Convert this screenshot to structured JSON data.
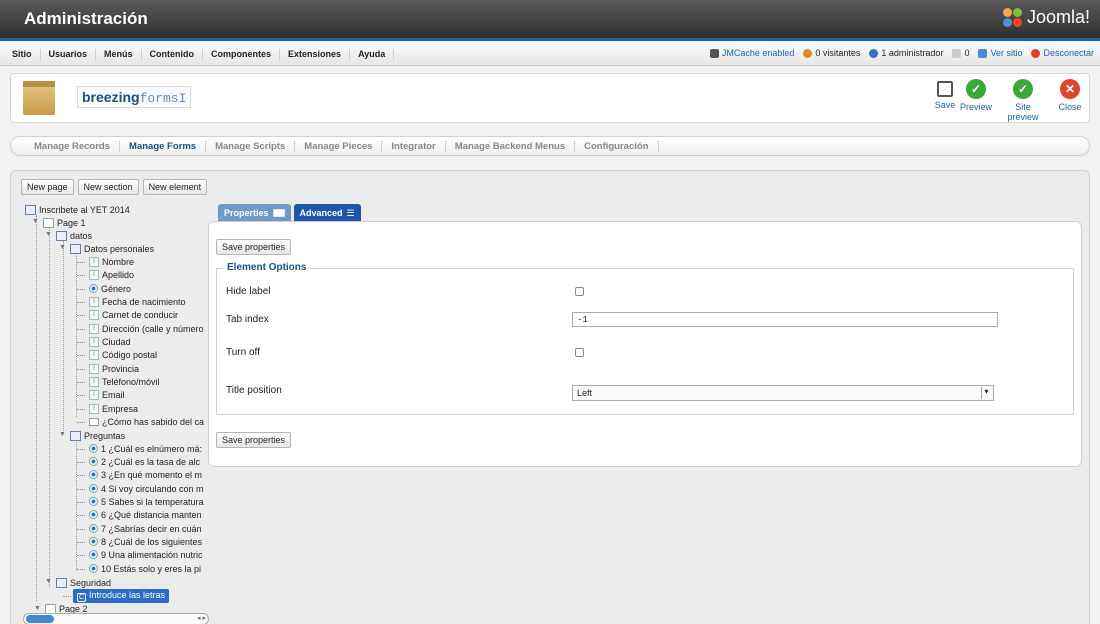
{
  "header": {
    "title": "Administración",
    "logo_text": "Joomla!"
  },
  "menu": {
    "items": [
      "Sitio",
      "Usuarios",
      "Menús",
      "Contenido",
      "Componentes",
      "Extensiones",
      "Ayuda"
    ]
  },
  "status": {
    "jmcache": "JMCache enabled",
    "visitors": "0 visitantes",
    "admins": "1 administrador",
    "messages": "0",
    "view_site": "Ver sitio",
    "logout": "Desconectar"
  },
  "toolbar": {
    "brand_bold": "breezing",
    "brand_light": "forms",
    "save": "Save",
    "preview": "Preview",
    "site_preview": "Site preview",
    "close": "Close"
  },
  "tabs": [
    "Manage Records",
    "Manage Forms",
    "Manage Scripts",
    "Manage Pieces",
    "Integrator",
    "Manage Backend Menus",
    "Configuración"
  ],
  "new_buttons": [
    "New page",
    "New section",
    "New element"
  ],
  "tree": {
    "root": "Inscribete al YET 2014",
    "page1": "Page 1",
    "datos": "datos",
    "datos_personales": "Datos personales",
    "fields": [
      "Nombre",
      "Apellido",
      "Género",
      "Fecha de nacimiento",
      "Carnet de conducir",
      "Dirección (calle y número",
      "Ciudad",
      "Código postal",
      "Provincia",
      "Teléfono/móvil",
      "Email",
      "Empresa",
      "¿Cómo has sabido del ca"
    ],
    "preguntas": "Preguntas",
    "questions": [
      "1 ¿Cuál es elnúmero má:",
      "2 ¿Cuál es la tasa de alc",
      "3 ¿En qué momento el m",
      "4 Si voy circulando con m",
      "5 Sabes si la temperatura",
      "6 ¿Qué distancia manten",
      "7 ¿Sabrías decir en cuán",
      "8 ¿Cuál de los siguientes",
      "9 Una alimentación nutric",
      "10 Estás solo y eres la pi"
    ],
    "seguridad": "Seguridad",
    "captcha": "Introduce las letras",
    "page2": "Page 2"
  },
  "panel": {
    "tab_properties": "Properties",
    "tab_advanced": "Advanced",
    "save_properties": "Save properties",
    "legend": "Element Options",
    "hide_label": "Hide label",
    "tab_index": "Tab index",
    "tab_index_value": "-1",
    "turn_off": "Turn off",
    "title_position": "Title position",
    "title_position_value": "Left"
  }
}
